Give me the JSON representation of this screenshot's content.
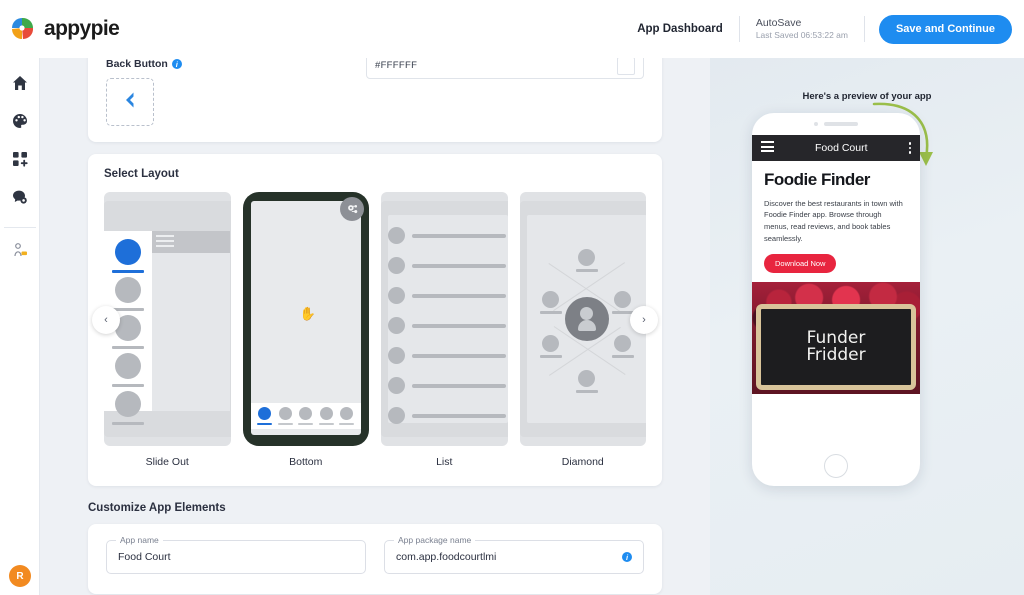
{
  "topbar": {
    "brand": "appypie",
    "app_dashboard": "App Dashboard",
    "autosave_label": "AutoSave",
    "autosave_time": "Last Saved 06:53:22 am",
    "save_button": "Save and Continue"
  },
  "sidebar": {
    "items": [
      {
        "icon": "home-icon",
        "label": "Home"
      },
      {
        "icon": "palette-icon",
        "label": "Design"
      },
      {
        "icon": "apps-add-icon",
        "label": "Pages"
      },
      {
        "icon": "chat-icon",
        "label": "Messages"
      },
      {
        "icon": "user-key-icon",
        "label": "Account"
      }
    ],
    "avatar_initial": "R"
  },
  "back_button_section": {
    "label": "Back Button",
    "info_glyph": "i",
    "color_value": "#FFFFFF",
    "icon": "chevron-left-icon"
  },
  "layout_section": {
    "title": "Select Layout",
    "prev_glyph": "‹",
    "next_glyph": "›",
    "selected_index": 1,
    "options": [
      {
        "caption": "Slide Out"
      },
      {
        "caption": "Bottom"
      },
      {
        "caption": "List"
      },
      {
        "caption": "Diamond"
      }
    ]
  },
  "customize_section": {
    "title": "Customize App Elements",
    "fields": [
      {
        "label": "App name",
        "value": "Food Court",
        "has_info": false
      },
      {
        "label": "App package name",
        "value": "com.app.foodcourtlmi",
        "has_info": true,
        "info_glyph": "i"
      }
    ]
  },
  "preview": {
    "title": "Here's a preview of your app",
    "arrow": "green-curved-arrow",
    "phone": {
      "appbar_title": "Food Court",
      "menu_icon": "hamburger-icon",
      "overflow_icon": "kebab-menu-icon",
      "heading": "Foodie Finder",
      "paragraph": "Discover the best restaurants in town with Foodie Finder app. Browse through menus, read reviews, and book tables seamlessly.",
      "cta": "Download Now",
      "image_caption_line1": "Funder",
      "image_caption_line2": "Fridder"
    }
  },
  "colors": {
    "accent_blue": "#1e8cf0",
    "cta_red": "#e8253f",
    "avatar_orange": "#f28a20",
    "selected_card": "#263229",
    "page_bg": "#eef1f5"
  }
}
